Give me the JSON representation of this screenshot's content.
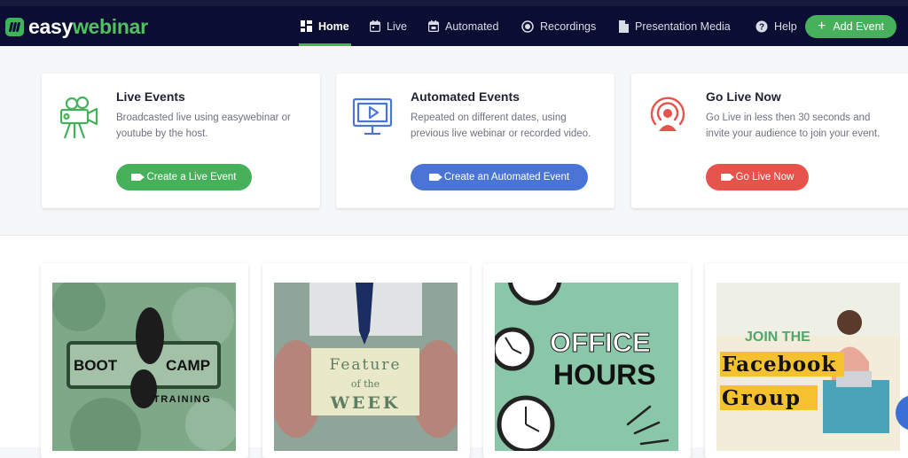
{
  "brand": {
    "name_part1": "easy",
    "name_part2": "webinar"
  },
  "nav": {
    "items": [
      {
        "label": "Home",
        "icon": "grid-icon"
      },
      {
        "label": "Live",
        "icon": "calendar-icon"
      },
      {
        "label": "Automated",
        "icon": "calendar-check-icon"
      },
      {
        "label": "Recordings",
        "icon": "record-icon"
      },
      {
        "label": "Presentation Media",
        "icon": "file-icon"
      },
      {
        "label": "Help",
        "icon": "help-icon"
      }
    ],
    "add_event_label": "Add Event"
  },
  "cards": [
    {
      "title": "Live Events",
      "description": "Broadcasted live using easywebinar or youtube by the host.",
      "button": "Create a Live Event",
      "color": "#46b05b",
      "icon": "movie-camera-icon"
    },
    {
      "title": "Automated Events",
      "description": "Repeated on different dates, using previous live webinar or recorded video.",
      "button": "Create an Automated Event",
      "color": "#4a74d6",
      "icon": "monitor-play-icon"
    },
    {
      "title": "Go Live Now",
      "description": "Go Live in less then 30 seconds and invite your audience to join your event.",
      "button": "Go Live Now",
      "color": "#e5534b",
      "icon": "broadcast-user-icon"
    }
  ],
  "events": [
    {
      "thumb_text": [
        "BOOT",
        "CAMP",
        "TRAINING"
      ]
    },
    {
      "thumb_text": [
        "Feature",
        "of the",
        "WEEK"
      ]
    },
    {
      "thumb_text": [
        "OFFICE",
        "HOURS"
      ]
    },
    {
      "thumb_text": [
        "JOIN THE",
        "Facebook",
        "Group"
      ]
    }
  ]
}
